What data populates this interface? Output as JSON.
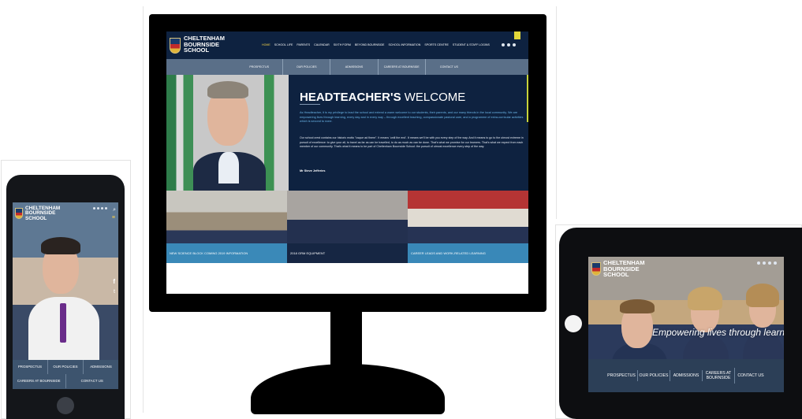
{
  "school": {
    "name_line1": "CHELTENHAM",
    "name_line2": "BOURNSIDE",
    "name_line3": "SCHOOL"
  },
  "desktop": {
    "nav": [
      "HOME",
      "SCHOOL LIFE",
      "PARENTS",
      "CALENDAR",
      "SIXTH FORM",
      "BEYOND BOURNSIDE",
      "SCHOOL INFORMATION",
      "SPORTS CENTRE",
      "STUDENT & STAFF LOGINS"
    ],
    "subnav": [
      "PROSPECTUS",
      "OUR POLICIES",
      "ADMISSIONS",
      "CAREERS AT BOURNSIDE",
      "CONTACT US"
    ],
    "hero_title_bold": "HEADTEACHER'S",
    "hero_title_light": "WELCOME",
    "hero_para1": "As Headteacher, it is my privilege to lead the school and extend a warm welcome to our students, their parents, and our many friends in the local community. We are empowering lives through learning, every day and in every way – through excellent teaching, compassionate pastoral care, and a programme of extra-curricular activities which is second to none.",
    "hero_para2": "Our school crest contains our historic motto \"usque ad finem\". It means 'until the end'. It means we'll be with you every step of the way. And it means to go to the utmost extreme in pursuit of excellence: to give your all, to travel as far as can be travelled, to do as much as can be done. That's what we promise for our learners. That's what we expect from each member of our community. That's what it means to be part of Cheltenham Bournside School: the pursuit of utmost excellence every step of the way.",
    "hero_signature": "Mr Steve Jefferies",
    "panels": [
      "NEW SCIENCE BLOCK COMING 2019 INFORMATION",
      "2018 GRM EQUIPMENT",
      "CAREER LEADS AND WORK-RELATED LEARNING"
    ]
  },
  "phone": {
    "nav_row1": [
      "PROSPECTUS",
      "OUR POLICIES",
      "ADMISSIONS"
    ],
    "nav_row2": [
      "CAREERS AT BOURNSIDE",
      "CONTACT US"
    ],
    "social_facebook": "f",
    "social_twitter": "t"
  },
  "tablet": {
    "tagline": "Empowering lives through learnin",
    "nav": [
      "PROSPECTUS",
      "OUR POLICIES",
      "ADMISSIONS",
      "CAREERS AT BOURNSIDE",
      "CONTACT US"
    ]
  },
  "colors": {
    "navy": "#0e2240",
    "accent_blue": "#3c96c8",
    "accent_yellow": "#e3d83a",
    "nav_slate": "#5a6f88"
  },
  "icons": [
    "search-icon",
    "menu-icon",
    "facebook-icon",
    "twitter-icon",
    "home-button-icon"
  ]
}
